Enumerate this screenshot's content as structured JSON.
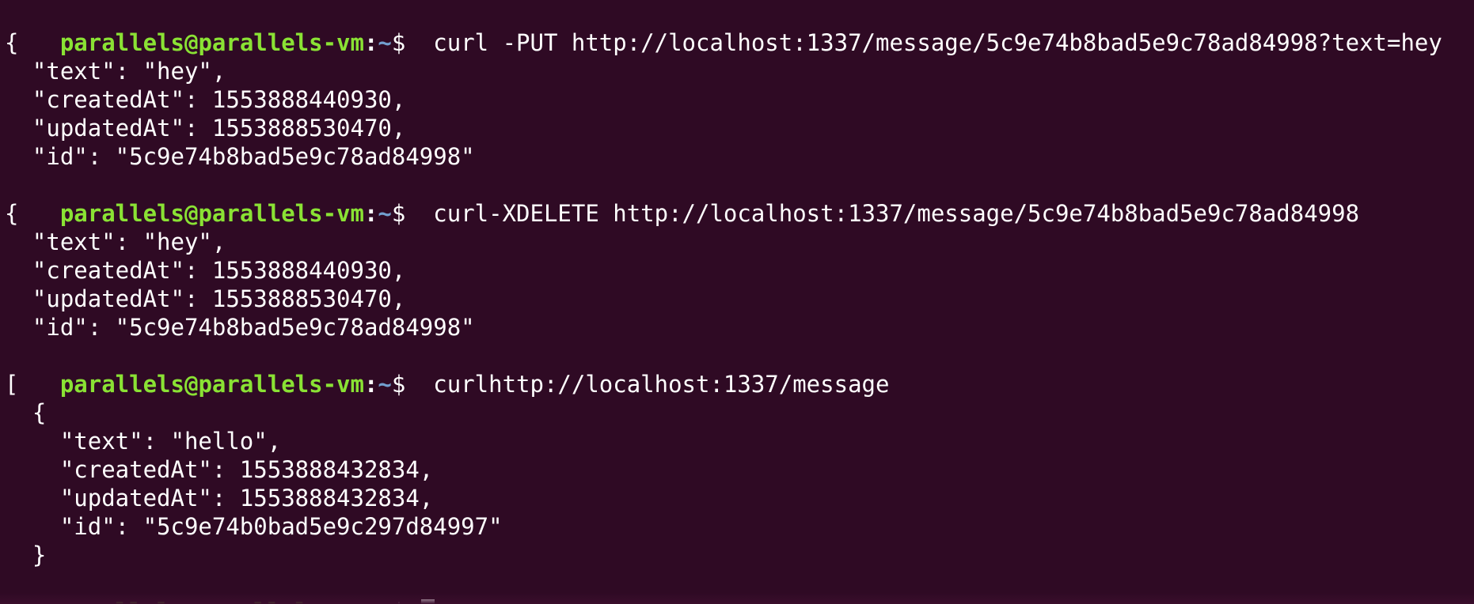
{
  "terminal": {
    "prompt": {
      "user": "parallels@parallels-vm",
      "sep": ":",
      "path": "~",
      "symbol": "$"
    },
    "lines": [
      {
        "kind": "command",
        "text": "  curl -PUT http://localhost:1337/message/5c9e74b8bad5e9c78ad84998?text=hey"
      },
      {
        "kind": "output",
        "text": "{"
      },
      {
        "kind": "output",
        "text": "  \"text\": \"hey\","
      },
      {
        "kind": "output",
        "text": "  \"createdAt\": 1553888440930,"
      },
      {
        "kind": "output",
        "text": "  \"updatedAt\": 1553888530470,"
      },
      {
        "kind": "output",
        "text": "  \"id\": \"5c9e74b8bad5e9c78ad84998\""
      },
      {
        "kind": "command",
        "text": "  curl-XDELETE http://localhost:1337/message/5c9e74b8bad5e9c78ad84998"
      },
      {
        "kind": "output",
        "text": "{"
      },
      {
        "kind": "output",
        "text": "  \"text\": \"hey\","
      },
      {
        "kind": "output",
        "text": "  \"createdAt\": 1553888440930,"
      },
      {
        "kind": "output",
        "text": "  \"updatedAt\": 1553888530470,"
      },
      {
        "kind": "output",
        "text": "  \"id\": \"5c9e74b8bad5e9c78ad84998\""
      },
      {
        "kind": "command",
        "text": "  curlhttp://localhost:1337/message"
      },
      {
        "kind": "output",
        "text": "["
      },
      {
        "kind": "output",
        "text": "  {"
      },
      {
        "kind": "output",
        "text": "    \"text\": \"hello\","
      },
      {
        "kind": "output",
        "text": "    \"createdAt\": 1553888432834,"
      },
      {
        "kind": "output",
        "text": "    \"updatedAt\": 1553888432834,"
      },
      {
        "kind": "output",
        "text": "    \"id\": \"5c9e74b0bad5e9c297d84997\""
      },
      {
        "kind": "output",
        "text": "  }"
      },
      {
        "kind": "command",
        "text": " "
      }
    ]
  }
}
